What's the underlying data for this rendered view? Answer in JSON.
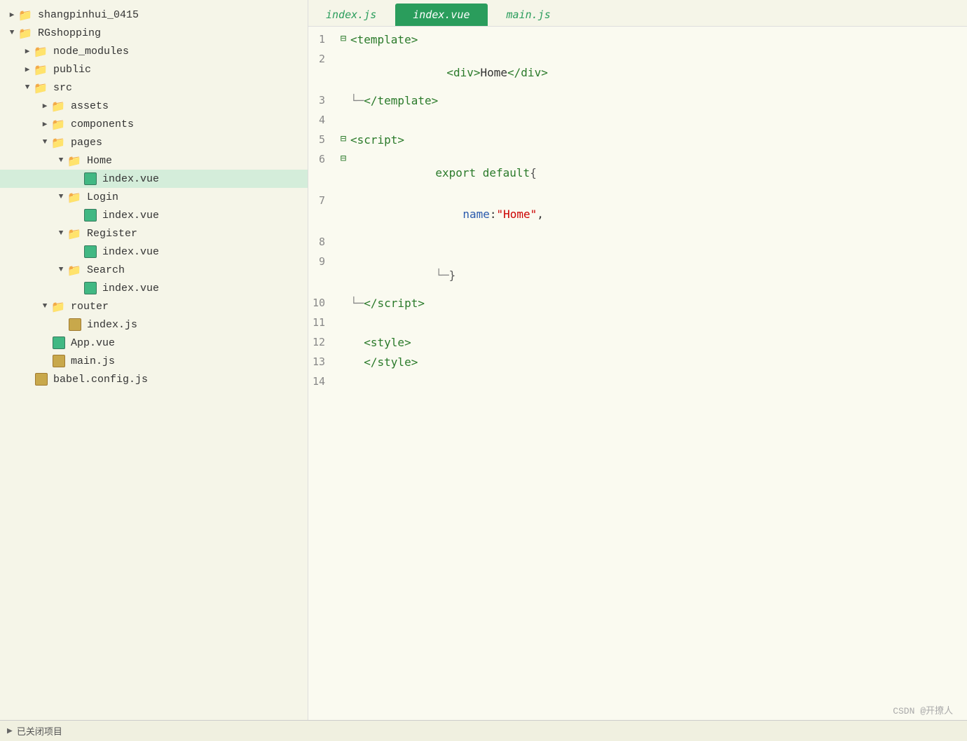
{
  "sidebar": {
    "items": [
      {
        "id": "shangpinhui",
        "label": "shangpinhui_0415",
        "type": "folder",
        "depth": 0,
        "arrow": "closed",
        "active": false
      },
      {
        "id": "rgshopping",
        "label": "RGshopping",
        "type": "folder",
        "depth": 0,
        "arrow": "open",
        "active": false
      },
      {
        "id": "node_modules",
        "label": "node_modules",
        "type": "folder",
        "depth": 1,
        "arrow": "closed",
        "active": false
      },
      {
        "id": "public",
        "label": "public",
        "type": "folder",
        "depth": 1,
        "arrow": "closed",
        "active": false
      },
      {
        "id": "src",
        "label": "src",
        "type": "folder",
        "depth": 1,
        "arrow": "open",
        "active": false
      },
      {
        "id": "assets",
        "label": "assets",
        "type": "folder",
        "depth": 2,
        "arrow": "closed",
        "active": false
      },
      {
        "id": "components",
        "label": "components",
        "type": "folder",
        "depth": 2,
        "arrow": "closed",
        "active": false
      },
      {
        "id": "pages",
        "label": "pages",
        "type": "folder",
        "depth": 2,
        "arrow": "open",
        "active": false
      },
      {
        "id": "home",
        "label": "Home",
        "type": "folder",
        "depth": 3,
        "arrow": "open",
        "active": false
      },
      {
        "id": "home-index-vue",
        "label": "index.vue",
        "type": "vue",
        "depth": 4,
        "arrow": "none",
        "active": true
      },
      {
        "id": "login",
        "label": "Login",
        "type": "folder",
        "depth": 3,
        "arrow": "open",
        "active": false
      },
      {
        "id": "login-index-vue",
        "label": "index.vue",
        "type": "vue",
        "depth": 4,
        "arrow": "none",
        "active": false
      },
      {
        "id": "register",
        "label": "Register",
        "type": "folder",
        "depth": 3,
        "arrow": "open",
        "active": false
      },
      {
        "id": "register-index-vue",
        "label": "index.vue",
        "type": "vue",
        "depth": 4,
        "arrow": "none",
        "active": false
      },
      {
        "id": "search",
        "label": "Search",
        "type": "folder",
        "depth": 3,
        "arrow": "open",
        "active": false
      },
      {
        "id": "search-index-vue",
        "label": "index.vue",
        "type": "vue",
        "depth": 4,
        "arrow": "none",
        "active": false
      },
      {
        "id": "router",
        "label": "router",
        "type": "folder",
        "depth": 2,
        "arrow": "open",
        "active": false
      },
      {
        "id": "router-index-js",
        "label": "index.js",
        "type": "js",
        "depth": 3,
        "arrow": "none",
        "active": false
      },
      {
        "id": "app-vue",
        "label": "App.vue",
        "type": "vue",
        "depth": 2,
        "arrow": "none",
        "active": false
      },
      {
        "id": "main-js",
        "label": "main.js",
        "type": "js",
        "depth": 2,
        "arrow": "none",
        "active": false
      },
      {
        "id": "babel-config",
        "label": "babel.config.js",
        "type": "js",
        "depth": 1,
        "arrow": "none",
        "active": false
      }
    ]
  },
  "tabs": [
    {
      "id": "index-js",
      "label": "index.js",
      "active": false
    },
    {
      "id": "index-vue",
      "label": "index.vue",
      "active": true
    },
    {
      "id": "main-js",
      "label": "main.js",
      "active": false
    }
  ],
  "code": {
    "lines": [
      {
        "num": 1,
        "fold": "⊟",
        "indent": 0,
        "html": "<span class='tag'>&lt;template&gt;</span>"
      },
      {
        "num": 2,
        "fold": "",
        "indent": 1,
        "html": "    <span class='tag'>&lt;div&gt;</span>Home<span class='tag'>&lt;/div&gt;</span>"
      },
      {
        "num": 3,
        "fold": "",
        "indent": 0,
        "html": "<span class='tag'>└─&lt;/template&gt;</span>"
      },
      {
        "num": 4,
        "fold": "",
        "indent": 0,
        "html": ""
      },
      {
        "num": 5,
        "fold": "⊟",
        "indent": 0,
        "html": "<span class='tag'>&lt;script&gt;</span>"
      },
      {
        "num": 6,
        "fold": "⊟",
        "indent": 1,
        "html": "    <span class='keyword'>export default</span><span class='bracket'>{</span>"
      },
      {
        "num": 7,
        "fold": "",
        "indent": 2,
        "html": "        <span class='property'>name</span>:<span class='string'>\"Home\"</span>,"
      },
      {
        "num": 8,
        "fold": "",
        "indent": 0,
        "html": ""
      },
      {
        "num": 9,
        "fold": "",
        "indent": 1,
        "html": "    <span class='bracket'>}</span>"
      },
      {
        "num": 10,
        "fold": "",
        "indent": 0,
        "html": "<span class='tag'>└─&lt;/script&gt;</span>"
      },
      {
        "num": 11,
        "fold": "",
        "indent": 0,
        "html": ""
      },
      {
        "num": 12,
        "fold": "",
        "indent": 1,
        "html": "  <span class='tag'>&lt;style&gt;</span>"
      },
      {
        "num": 13,
        "fold": "",
        "indent": 1,
        "html": "  <span class='tag'>&lt;/style&gt;</span>"
      },
      {
        "num": 14,
        "fold": "",
        "indent": 0,
        "html": ""
      }
    ]
  },
  "bottom_bar": {
    "label": "已关闭项目"
  },
  "watermark": "CSDN @开撩人"
}
